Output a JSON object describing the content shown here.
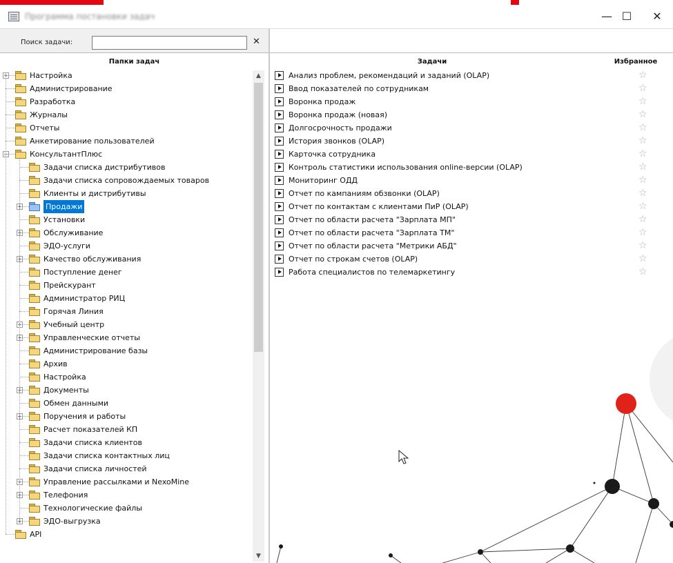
{
  "window": {
    "title": "Программа постановки задач",
    "controls": {
      "minimize": "—",
      "maximize": "☐",
      "close": "✕"
    }
  },
  "search": {
    "label": "Поиск задачи:",
    "value": "",
    "clear": "✕"
  },
  "left_pane": {
    "header": "Папки задач",
    "tree": [
      {
        "label": "Настройка",
        "level": 0,
        "expandable": true
      },
      {
        "label": "Администрирование",
        "level": 0
      },
      {
        "label": "Разработка",
        "level": 0
      },
      {
        "label": "Журналы",
        "level": 0
      },
      {
        "label": "Отчеты",
        "level": 0
      },
      {
        "label": "Анкетирование пользователей",
        "level": 0
      },
      {
        "label": "КонсультантПлюс",
        "level": 0,
        "expandable": true,
        "expanded": true
      },
      {
        "label": "Задачи списка дистрибутивов",
        "level": 1
      },
      {
        "label": "Задачи списка сопровождаемых товаров",
        "level": 1
      },
      {
        "label": "Клиенты и дистрибутивы",
        "level": 1
      },
      {
        "label": "Продажи",
        "level": 1,
        "expandable": true,
        "selected": true
      },
      {
        "label": "Установки",
        "level": 1
      },
      {
        "label": "Обслуживание",
        "level": 1,
        "expandable": true
      },
      {
        "label": "ЭДО-услуги",
        "level": 1
      },
      {
        "label": "Качество обслуживания",
        "level": 1,
        "expandable": true
      },
      {
        "label": "Поступление денег",
        "level": 1
      },
      {
        "label": "Прейскурант",
        "level": 1
      },
      {
        "label": "Администратор РИЦ",
        "level": 1
      },
      {
        "label": "Горячая Линия",
        "level": 1
      },
      {
        "label": "Учебный центр",
        "level": 1,
        "expandable": true
      },
      {
        "label": "Управленческие отчеты",
        "level": 1,
        "expandable": true
      },
      {
        "label": "Администрирование базы",
        "level": 1
      },
      {
        "label": "Архив",
        "level": 1
      },
      {
        "label": "Настройка",
        "level": 1
      },
      {
        "label": "Документы",
        "level": 1,
        "expandable": true
      },
      {
        "label": "Обмен данными",
        "level": 1
      },
      {
        "label": "Поручения и работы",
        "level": 1,
        "expandable": true
      },
      {
        "label": "Расчет показателей КП",
        "level": 1
      },
      {
        "label": "Задачи списка клиентов",
        "level": 1
      },
      {
        "label": "Задачи списка контактных лиц",
        "level": 1
      },
      {
        "label": "Задачи списка личностей",
        "level": 1
      },
      {
        "label": "Управление рассылками и NexoMine",
        "level": 1,
        "expandable": true
      },
      {
        "label": "Телефония",
        "level": 1,
        "expandable": true
      },
      {
        "label": "Технологические файлы",
        "level": 1
      },
      {
        "label": "ЭДО-выгрузка",
        "level": 1,
        "expandable": true
      },
      {
        "label": "API",
        "level": 0
      }
    ]
  },
  "right_pane": {
    "col_tasks": "Задачи",
    "col_favorites": "Избранное",
    "tasks": [
      "Анализ проблем, рекомендаций и заданий (OLAP)",
      "Ввод показателей по сотрудникам",
      "Воронка продаж",
      "Воронка продаж (новая)",
      "Долгосрочность продажи",
      "История звонков (OLAP)",
      "Карточка сотрудника",
      "Контроль статистики использования online-версии (OLAP)",
      "Мониторинг ОДД",
      "Отчет по кампаниям обзвонки (OLAP)",
      "Отчет по контактам с клиентами ПиР (OLAP)",
      "Отчет по области расчета \"Зарплата МП\"",
      "Отчет по области расчета \"Зарплата ТМ\"",
      "Отчет по области расчета \"Метрики АБД\"",
      "Отчет по строкам счетов (OLAP)",
      "Работа специалистов по телемаркетингу"
    ]
  },
  "colors": {
    "accent_red": "#e30613",
    "selection": "#0078d7",
    "node_red": "#e0221b"
  }
}
